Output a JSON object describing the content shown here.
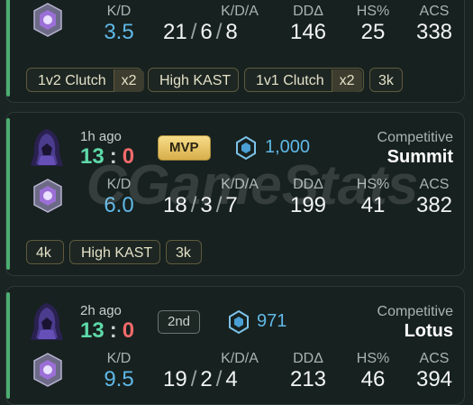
{
  "matches": [
    {
      "stats": {
        "kd_label": "K/D",
        "kd_value": "3.5",
        "kda_label": "K/D/A",
        "kills": "21",
        "deaths": "6",
        "assists": "8",
        "dda_label": "DDΔ",
        "dda_value": "146",
        "hs_label": "HS%",
        "hs_value": "25",
        "acs_label": "ACS",
        "acs_value": "338"
      },
      "tags": [
        {
          "label": "1v2 Clutch",
          "mult": "x2"
        },
        {
          "label": "High KAST"
        },
        {
          "label": "1v1 Clutch",
          "mult": "x2"
        },
        {
          "label": "3k"
        }
      ]
    },
    {
      "time": "1h ago",
      "score": {
        "won": "13",
        "lost": "0",
        "sep": ":"
      },
      "badge": "MVP",
      "rr": "1,000",
      "mode": "Competitive",
      "map": "Summit",
      "stats": {
        "kd_label": "K/D",
        "kd_value": "6.0",
        "kda_label": "K/D/A",
        "kills": "18",
        "deaths": "3",
        "assists": "7",
        "dda_label": "DDΔ",
        "dda_value": "199",
        "hs_label": "HS%",
        "hs_value": "41",
        "acs_label": "ACS",
        "acs_value": "382"
      },
      "tags": [
        {
          "label": "4k"
        },
        {
          "label": "High KAST"
        },
        {
          "label": "3k"
        }
      ]
    },
    {
      "time": "2h ago",
      "score": {
        "won": "13",
        "lost": "0",
        "sep": ":"
      },
      "badge": "2nd",
      "rr": "971",
      "mode": "Competitive",
      "map": "Lotus",
      "stats": {
        "kd_label": "K/D",
        "kd_value": "9.5",
        "kda_label": "K/D/A",
        "kills": "19",
        "deaths": "2",
        "assists": "4",
        "dda_label": "DDΔ",
        "dda_value": "213",
        "hs_label": "HS%",
        "hs_value": "46",
        "acs_label": "ACS",
        "acs_value": "394"
      }
    }
  ],
  "watermark": "CGameStats",
  "colors": {
    "accent_green": "#4caf72",
    "kd_blue": "#5fb8e8",
    "win_green": "#5ed8a8",
    "loss_red": "#f06a6a",
    "mvp_gold": "#e8c464"
  },
  "icons": {
    "agent": "hooded-agent-icon",
    "rank": "immortal-rank-icon",
    "rr_rank": "radiant-rank-icon"
  }
}
